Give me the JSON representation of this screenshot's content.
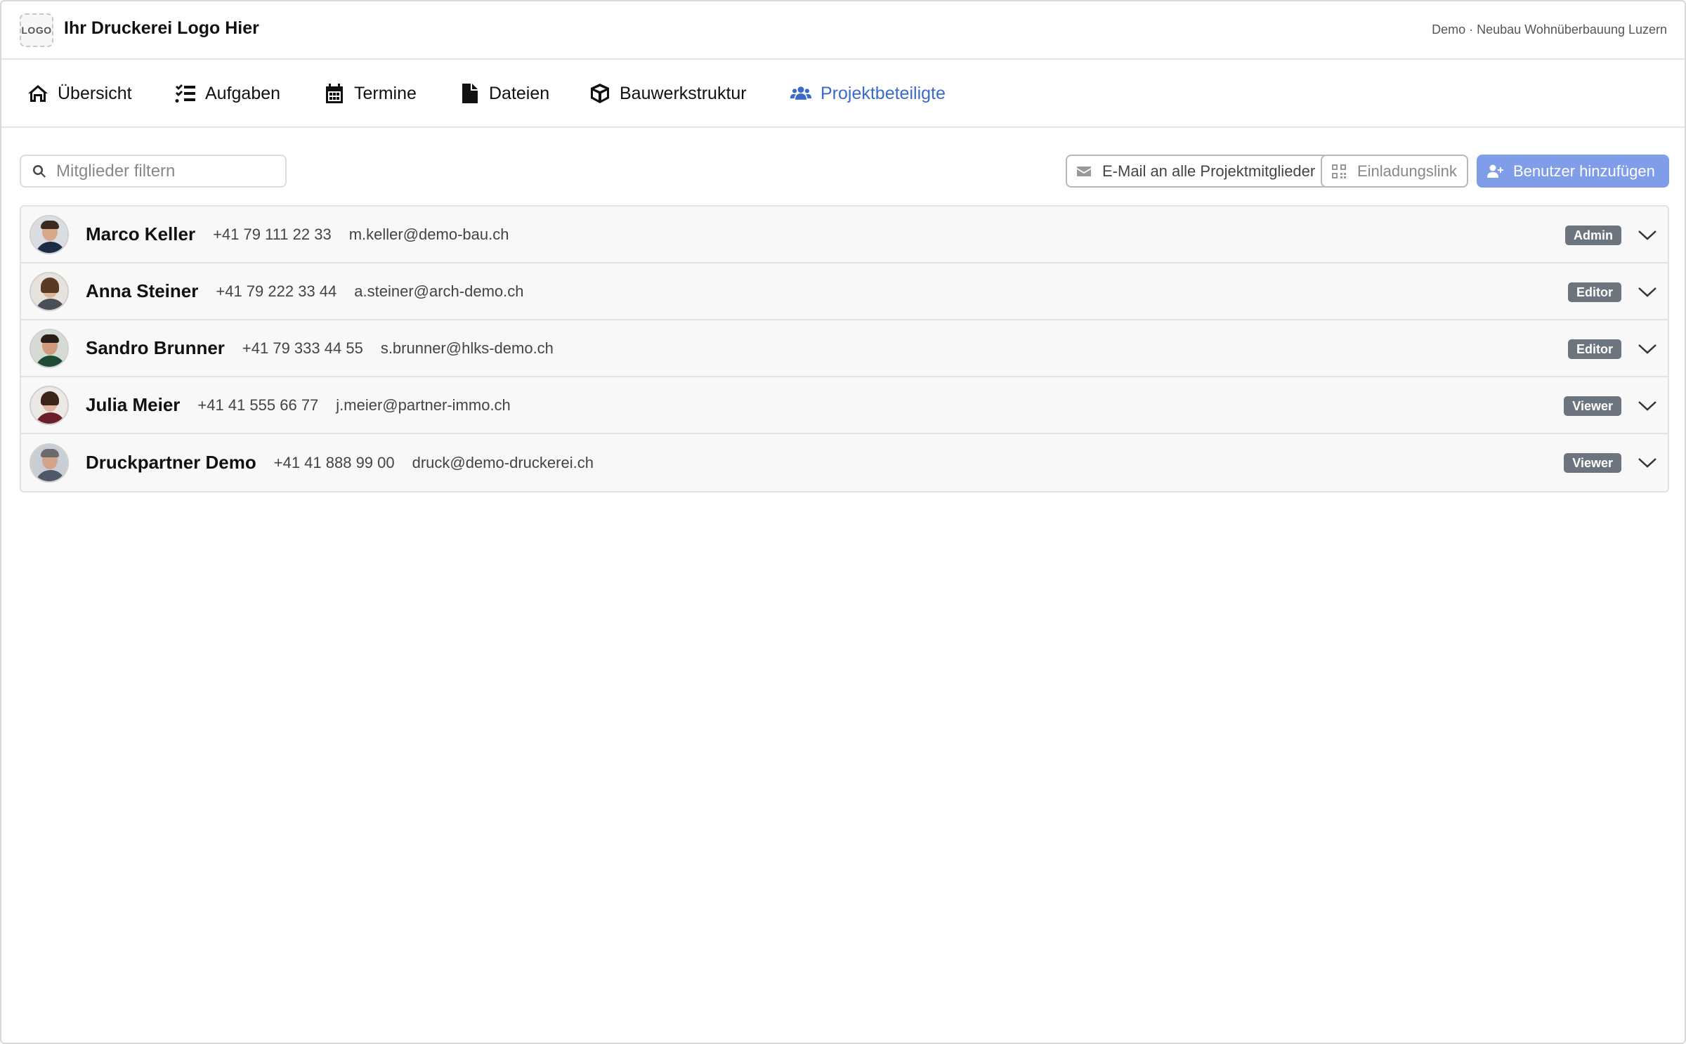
{
  "header": {
    "logo_text": "LOGO",
    "brand": "Ihr Druckerei Logo Hier",
    "project_info": "Demo · Neubau Wohnüberbauung Luzern"
  },
  "tabs": [
    {
      "label": "Übersicht",
      "icon": "home-icon"
    },
    {
      "label": "Aufgaben",
      "icon": "task-list-icon"
    },
    {
      "label": "Termine",
      "icon": "calendar-icon"
    },
    {
      "label": "Dateien",
      "icon": "file-icon"
    },
    {
      "label": "Bauwerkstruktur",
      "icon": "cube-icon"
    },
    {
      "label": "Projektbeteiligte",
      "icon": "users-icon",
      "active": true
    }
  ],
  "toolbar": {
    "filter_placeholder": "Mitglieder filtern",
    "email_all_label": "E-Mail an alle Projektmitglieder",
    "invite_link_label": "Einladungslink",
    "add_user_label": "Benutzer hinzufügen"
  },
  "members": [
    {
      "name": "Marco Keller",
      "phone": "+41 79 111 22 33",
      "email": "m.keller@demo-bau.ch",
      "role": "Admin"
    },
    {
      "name": "Anna Steiner",
      "phone": "+41 79 222 33 44",
      "email": "a.steiner@arch-demo.ch",
      "role": "Editor"
    },
    {
      "name": "Sandro Brunner",
      "phone": "+41 79 333 44 55",
      "email": "s.brunner@hlks-demo.ch",
      "role": "Editor"
    },
    {
      "name": "Julia Meier",
      "phone": "+41 41 555 66 77",
      "email": "j.meier@partner-immo.ch",
      "role": "Viewer"
    },
    {
      "name": "Druckpartner Demo",
      "phone": "+41 41 888 99 00",
      "email": "druck@demo-druckerei.ch",
      "role": "Viewer"
    }
  ],
  "colors": {
    "accent": "#3b6bc9",
    "primary_button": "#7f9de8",
    "badge": "#6c757d"
  }
}
